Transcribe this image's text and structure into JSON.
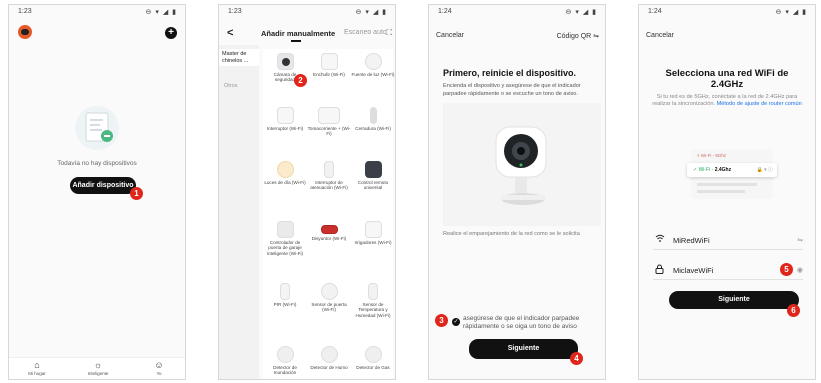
{
  "colors": {
    "badge": "#e0261b",
    "button": "#111111",
    "link": "#1a73e8",
    "accent_orange": "#e55a28"
  },
  "status_bar": [
    {
      "time": "1:23",
      "icons": "⊖ ▾ ◢ ▮"
    },
    {
      "time": "1:23",
      "icons": "⊖ ▾ ◢ ▮"
    },
    {
      "time": "1:24",
      "icons": "⊖ ▾ ◢ ▮"
    },
    {
      "time": "1:24",
      "icons": "⊖ ▾ ◢ ▮"
    }
  ],
  "screen1": {
    "empty_text": "Todavía no hay dispositivos",
    "add_button": "Añadir dispositivo",
    "badge": "1",
    "nav": [
      {
        "icon": "home-icon",
        "label": "Mi hogar"
      },
      {
        "icon": "sun-icon",
        "label": "Inteligente"
      },
      {
        "icon": "user-icon",
        "label": "Yo"
      }
    ]
  },
  "screen2": {
    "back": "<",
    "tab_manual": "Añadir manualmente",
    "tab_scan": "Escaneo auto",
    "sidebar": [
      "Master de chinelos ...",
      "Otros"
    ],
    "badge": "2",
    "devices": [
      {
        "label": "Cámara de seguridad",
        "icon": "camera-icon"
      },
      {
        "label": "Enchufe (Wi-Fi)",
        "icon": "plug-icon"
      },
      {
        "label": "Fuente de luz (Wi-Fi)",
        "icon": "bulb-icon"
      },
      {
        "label": "Interruptor (Wi-Fi)",
        "icon": "switch-icon"
      },
      {
        "label": "Tomacorriente + (Wi-Fi)",
        "icon": "socket-icon"
      },
      {
        "label": "Cerradura (Wi-Fi)",
        "icon": "lock-icon"
      },
      {
        "label": "Luces de día (Wi-Fi)",
        "icon": "daylight-icon"
      },
      {
        "label": "Interruptor de atenuación (Wi-Fi)",
        "icon": "dimmer-icon"
      },
      {
        "label": "Control remoto universal",
        "icon": "remote-icon"
      },
      {
        "label": "Controlador de puerta de garaje inteligente (Wi-Fi)",
        "icon": "garage-icon"
      },
      {
        "label": "Disyuntor (Wi-Fi)",
        "icon": "breaker-icon"
      },
      {
        "label": "Irrigadores (Wi-Fi)",
        "icon": "sprinkler-icon"
      },
      {
        "label": "PIR (Wi-Fi)",
        "icon": "pir-icon"
      },
      {
        "label": "Sensor de puerta (Wi-Fi)",
        "icon": "door-sensor-icon"
      },
      {
        "label": "Sensor de Temperatura y Humedad (Wi-Fi)",
        "icon": "thermometer-icon"
      },
      {
        "label": "Detector de Inundación",
        "icon": "flood-icon"
      },
      {
        "label": "Detector de Humo",
        "icon": "smoke-icon"
      },
      {
        "label": "Detector de Gas",
        "icon": "gas-icon"
      }
    ]
  },
  "screen3": {
    "cancel": "Cancelar",
    "qr": "Código QR ⇋",
    "title": "Primero, reinicie el dispositivo.",
    "desc": "Encienda el dispositivo y asegúrese de que el indicador parpadee rápidamente o se escuche un tono de aviso.",
    "note": "Realice el emparejamiento de la red como se le solicita",
    "checkbox_text": "asegúrese de que el indicador parpadee rápidamente o se oiga un tono de aviso",
    "next_button": "Siguiente",
    "badge_check": "3",
    "badge_next": "4"
  },
  "screen4": {
    "cancel": "Cancelar",
    "title": "Selecciona una red WiFi de 2.4GHz",
    "sub": "Si tu red es de 5GHz, conéctate a la red de 2.4GHz para realizar la sincronización.",
    "sub_link": "Método de ajuste de router común",
    "router_top": "× Wi-Fi - 5Ghz",
    "router_sel_prefix": "✓ Wi-Fi - ",
    "router_sel_band": "2.4Ghz",
    "router_sel_icons": "🔒 ▾ ⓘ",
    "wifi_name": "MiRedWiFi",
    "wifi_switch": "⇋",
    "password": "MiclaveWiFi",
    "eye": "◉",
    "next_button": "Siguiente",
    "badge_pw": "5",
    "badge_next": "6"
  }
}
